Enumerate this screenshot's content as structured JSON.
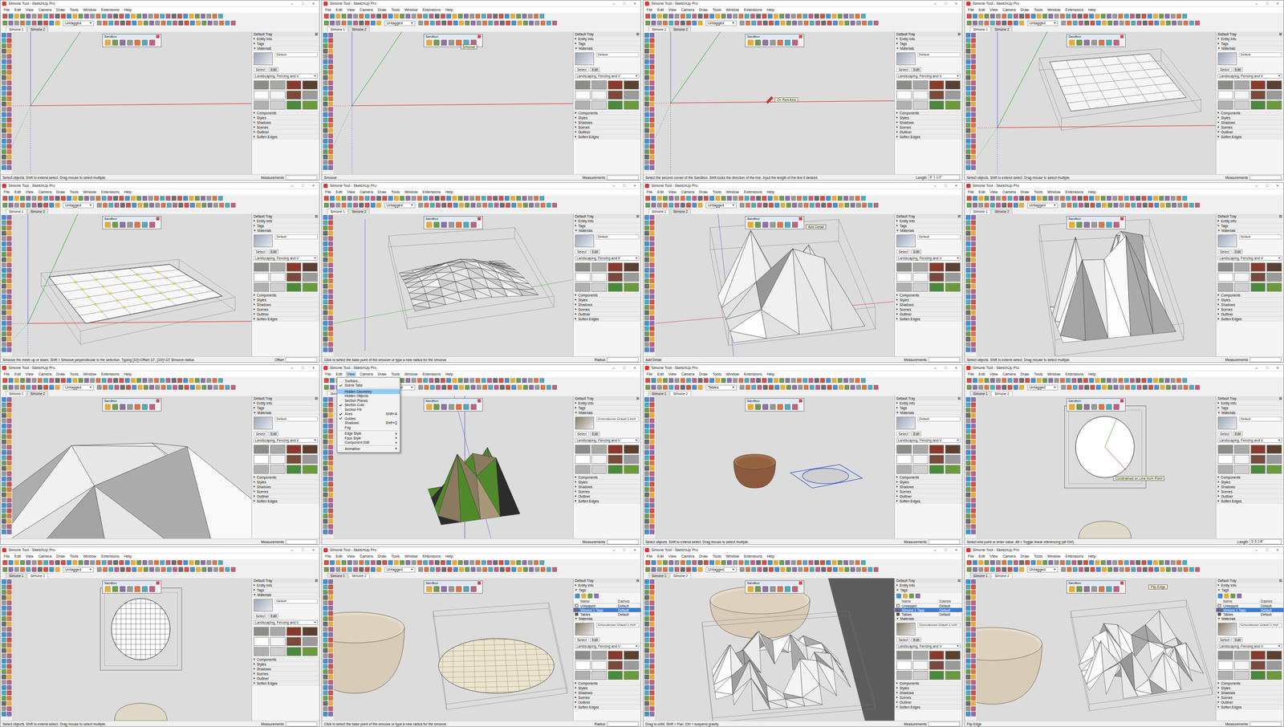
{
  "app": {
    "title": "Simone Tool - SketchUp Pro",
    "window_controls": [
      "–",
      "□",
      "×"
    ],
    "menu": [
      "File",
      "Edit",
      "View",
      "Camera",
      "Draw",
      "Tools",
      "Window",
      "Extensions",
      "Help"
    ],
    "tabs": [
      "Simone 1",
      "Simone 2"
    ],
    "sandbox_title": "Sandbox",
    "measurements_label": "Measurements",
    "tray": {
      "title": "Default Tray",
      "entity_info": {
        "label": "Entity Info",
        "expanded": false
      },
      "tags_label": "Tags",
      "materials": {
        "label": "Materials",
        "expanded": true
      },
      "material_tabs": [
        {
          "label": "Select",
          "selected": true
        },
        {
          "label": "Edit",
          "selected": false
        }
      ],
      "library": "Landscaping, Fencing and V",
      "bottom": [
        {
          "label": "Components",
          "expanded": false
        },
        {
          "label": "Styles",
          "expanded": false
        },
        {
          "label": "Shadows",
          "expanded": false
        },
        {
          "label": "Scenes",
          "expanded": false
        },
        {
          "label": "Outliner",
          "expanded": false
        },
        {
          "label": "Soften Edges",
          "expanded": false
        }
      ],
      "tag_columns": [
        "Name",
        "Dashes"
      ],
      "tag_rows": [
        {
          "name": "Untagged",
          "dashes": "Default",
          "selected": false,
          "color": "#f2f2f2"
        },
        {
          "name": "Simone 1 Tags",
          "dashes": "Default",
          "selected": true,
          "color": "#c0504d"
        },
        {
          "name": "Tables",
          "dashes": "Default",
          "selected": false,
          "color": "#6b4a2a"
        }
      ]
    },
    "view_menu": [
      {
        "label": "Toolbars...",
        "shortcut": "",
        "checked": false,
        "highlighted": false,
        "submenu": false,
        "separator_before": false
      },
      {
        "label": "Scene Tabs",
        "shortcut": "",
        "checked": true,
        "highlighted": false,
        "submenu": false,
        "separator_before": false
      },
      {
        "label": "Hidden Geometry",
        "shortcut": "",
        "checked": false,
        "highlighted": true,
        "submenu": false,
        "separator_before": true
      },
      {
        "label": "Hidden Objects",
        "shortcut": "",
        "checked": false,
        "highlighted": false,
        "submenu": false,
        "separator_before": false
      },
      {
        "label": "Section Planes",
        "shortcut": "",
        "checked": false,
        "highlighted": false,
        "submenu": false,
        "separator_before": false
      },
      {
        "label": "Section Cuts",
        "shortcut": "",
        "checked": true,
        "highlighted": false,
        "submenu": false,
        "separator_before": false
      },
      {
        "label": "Section Fill",
        "shortcut": "",
        "checked": false,
        "highlighted": false,
        "submenu": false,
        "separator_before": false
      },
      {
        "label": "Axes",
        "shortcut": "Shift+A",
        "checked": true,
        "highlighted": false,
        "submenu": false,
        "separator_before": false
      },
      {
        "label": "Guides",
        "shortcut": "",
        "checked": true,
        "highlighted": false,
        "submenu": false,
        "separator_before": false
      },
      {
        "label": "Shadows",
        "shortcut": "Shift+Q",
        "checked": false,
        "highlighted": false,
        "submenu": false,
        "separator_before": false
      },
      {
        "label": "Fog",
        "shortcut": "",
        "checked": false,
        "highlighted": false,
        "submenu": false,
        "separator_before": false
      },
      {
        "label": "Edge Style",
        "shortcut": "",
        "checked": false,
        "highlighted": false,
        "submenu": true,
        "separator_before": true
      },
      {
        "label": "Face Style",
        "shortcut": "",
        "checked": false,
        "highlighted": false,
        "submenu": true,
        "separator_before": false
      },
      {
        "label": "Component Edit",
        "shortcut": "",
        "checked": false,
        "highlighted": false,
        "submenu": true,
        "separator_before": false
      },
      {
        "label": "Animation",
        "shortcut": "",
        "checked": false,
        "highlighted": false,
        "submenu": true,
        "separator_before": true
      }
    ]
  },
  "tiles": [
    {
      "scene": "axes",
      "tabs_selected": [
        true,
        false
      ],
      "tag": "Untagged",
      "status": "Select objects. Shift to extend select. Drag mouse to select multiple.",
      "value_label": "Measurements",
      "value": "",
      "tooltip": "",
      "view_menu_open": false,
      "tags_expanded": false,
      "material": "Default",
      "material_color": "#9aa6b8"
    },
    {
      "scene": "axes",
      "tabs_selected": [
        true,
        false
      ],
      "tag": "Untagged",
      "status": "Smoove",
      "value_label": "Measurements",
      "value": "",
      "tooltip": "Smoove",
      "view_menu_open": false,
      "tags_expanded": false,
      "material": "Default",
      "material_color": "#9aa6b8"
    },
    {
      "scene": "axes-drag",
      "tabs_selected": [
        true,
        false
      ],
      "tag": "Untagged",
      "status": "Select the second corner of the Sandbox. Shift locks the direction of the line. Input the length of the line if desired.",
      "value_label": "Length",
      "value": "6' 1 1/2\"",
      "tooltip": "On Red Axis",
      "view_menu_open": false,
      "tags_expanded": false,
      "material": "Default",
      "material_color": "#9aa6b8"
    },
    {
      "scene": "grid-box",
      "tabs_selected": [
        true,
        false
      ],
      "tag": "Untagged",
      "status": "Select objects. Shift to extend select. Drag mouse to select multiple.",
      "value_label": "Measurements",
      "value": "",
      "tooltip": "",
      "view_menu_open": false,
      "tags_expanded": false,
      "material": "Default",
      "material_color": "#9aa6b8"
    },
    {
      "scene": "grid-selected",
      "tabs_selected": [
        true,
        false
      ],
      "tag": "Untagged",
      "status": "Smoove the mesh up or down. Shift = Smoove perpendicular to the selection. Typing [10]=Offset 10', [10r]=10' Smoove radius",
      "value_label": "Offset",
      "value": "",
      "tooltip": "",
      "view_menu_open": false,
      "tags_expanded": false,
      "material": "Default",
      "material_color": "#9aa6b8"
    },
    {
      "scene": "smooth",
      "tabs_selected": [
        true,
        false
      ],
      "tag": "Untagged",
      "status": "Click to select the base point of the smoove or type a new radius for the smoove.",
      "value_label": "Radius",
      "value": "",
      "tooltip": "",
      "view_menu_open": false,
      "tags_expanded": false,
      "material": "Default",
      "material_color": "#9aa6b8"
    },
    {
      "scene": "peaks",
      "tabs_selected": [
        true,
        false
      ],
      "tag": "Untagged",
      "status": "Add Detail",
      "value_label": "Measurements",
      "value": "",
      "tooltip": "Add Detail",
      "view_menu_open": false,
      "tags_expanded": false,
      "material": "Default",
      "material_color": "#9aa6b8"
    },
    {
      "scene": "peaks-tall",
      "tabs_selected": [
        true,
        false
      ],
      "tag": "Untagged",
      "status": "Select objects. Shift to extend select. Drag mouse to select multiple.",
      "value_label": "Measurements",
      "value": "",
      "tooltip": "",
      "view_menu_open": false,
      "tags_expanded": false,
      "material": "Default",
      "material_color": "#9aa6b8"
    },
    {
      "scene": "closeup",
      "tabs_selected": [
        true,
        false
      ],
      "tag": "Untagged",
      "status": "",
      "value_label": "Measurements",
      "value": "",
      "tooltip": "",
      "view_menu_open": false,
      "tags_expanded": false,
      "material": "Default",
      "material_color": "#9aa6b8"
    },
    {
      "scene": "colored",
      "tabs_selected": [
        true,
        false
      ],
      "tag": "Untagged",
      "status": "",
      "value_label": "Measurements",
      "value": "",
      "tooltip": "",
      "view_menu_open": true,
      "tags_expanded": false,
      "material": "Groundcover Gravel 1 inch",
      "material_color": "#8a7a60"
    },
    {
      "scene": "bowl-circle",
      "tabs_selected": [
        false,
        true
      ],
      "tag": "Tables",
      "status": "Select objects. Shift to extend select. Drag mouse to select multiple.",
      "value_label": "Measurements",
      "value": "",
      "tooltip": "",
      "view_menu_open": false,
      "tags_expanded": false,
      "material": "Default",
      "material_color": "#9aa6b8"
    },
    {
      "scene": "circle-top",
      "tabs_selected": [
        false,
        true
      ],
      "tag": "Untagged",
      "status": "Select end point or enter value. Alt = Toggle linear inferencing (alt Ctrl).",
      "value_label": "Length",
      "value": "3' 5 1/8\"",
      "tooltip": "Constrained on Line from Point",
      "view_menu_open": false,
      "tags_expanded": false,
      "material": "Default",
      "material_color": "#9aa6b8"
    },
    {
      "scene": "circle-grid",
      "tabs_selected": [
        false,
        true
      ],
      "tag": "Untagged",
      "status": "Select objects. Shift to extend select. Drag mouse to select multiple.",
      "value_label": "Measurements",
      "value": "",
      "tooltip": "",
      "view_menu_open": false,
      "tags_expanded": false,
      "material": "Default",
      "material_color": "#9aa6b8"
    },
    {
      "scene": "bowl-disc",
      "tabs_selected": [
        false,
        true
      ],
      "tag": "Untagged",
      "status": "Click to select the base point of the smoove or type a new radius for the smoove.",
      "value_label": "Radius",
      "value": "",
      "tooltip": "",
      "view_menu_open": false,
      "tags_expanded": true,
      "material": "Groundcover Gravel 1 inch",
      "material_color": "#8a7a60"
    },
    {
      "scene": "bowl-peaks",
      "tabs_selected": [
        false,
        true
      ],
      "tag": "Untagged",
      "status": "Drag to orbit. Shift = Pan, Ctrl = suspend gravity.",
      "value_label": "Measurements",
      "value": "",
      "tooltip": "",
      "view_menu_open": false,
      "tags_expanded": true,
      "material": "Groundcover Gravel 1 inch",
      "material_color": "#8a7a60"
    },
    {
      "scene": "peaks-ring",
      "tabs_selected": [
        false,
        true
      ],
      "tag": "Untagged",
      "status": "Flip Edge",
      "value_label": "Measurements",
      "value": "",
      "tooltip": "Flip Edge",
      "view_menu_open": false,
      "tags_expanded": true,
      "material": "Groundcover Gravel 1 inch",
      "material_color": "#8a7a60"
    }
  ]
}
